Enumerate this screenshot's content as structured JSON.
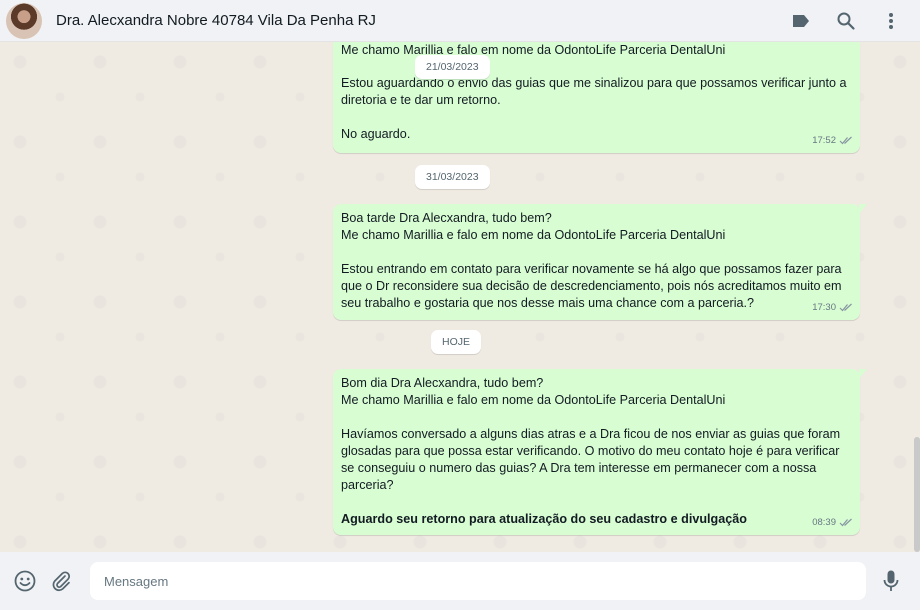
{
  "header": {
    "contact_name": "Dra. Alecxandra Nobre 40784 Vila Da Penha RJ",
    "icons": [
      "label-icon",
      "search-icon",
      "more-vertical-icon"
    ]
  },
  "messages": [
    {
      "lines": [
        "Me chamo Marillia e falo em nome da OdontoLife Parceria DentalUni",
        "Estou aguardando o envio das guias que me sinalizou para que possamos verificar junto a",
        "diretoria e te dar um retorno.",
        "",
        "No aguardo."
      ],
      "time": "17:52"
    },
    {
      "lines": [
        "Boa tarde Dra Alecxandra, tudo bem?",
        "Me chamo Marillia e falo em nome da OdontoLife Parceria DentalUni",
        "",
        "Estou entrando em contato para verificar novamente se há algo que possamos fazer para",
        "que o Dr reconsidere sua decisão de descredenciamento, pois nós acreditamos muito em",
        "seu trabalho e gostaria que nos desse mais uma chance com a parceria.?"
      ],
      "time": "17:30"
    },
    {
      "lines": [
        "Bom dia Dra Alecxandra, tudo bem?",
        "Me chamo Marillia e falo em nome da OdontoLife Parceria DentalUni",
        "",
        "Havíamos conversado a alguns dias atras e a Dra ficou de nos enviar as guias que foram",
        "glosadas para que possa estar verificando. O motivo do meu contato hoje é para verificar",
        "se conseguiu o numero das guias? A Dra tem interesse em permanecer com a nossa",
        "parceria?",
        ""
      ],
      "bold_line": "Aguardo seu retorno para atualização do seu cadastro e divulgação",
      "time": "08:39"
    }
  ],
  "date_separators": [
    "21/03/2023",
    "31/03/2023",
    "HOJE"
  ],
  "footer": {
    "placeholder": "Mensagem",
    "icons": [
      "emoji-icon",
      "attach-icon",
      "microphone-icon"
    ]
  },
  "colors": {
    "outgoing_bubble": "#d9fdd3",
    "chat_background": "#efeae2",
    "header_background": "#f0f2f5",
    "tick_color": "#8696a0"
  }
}
